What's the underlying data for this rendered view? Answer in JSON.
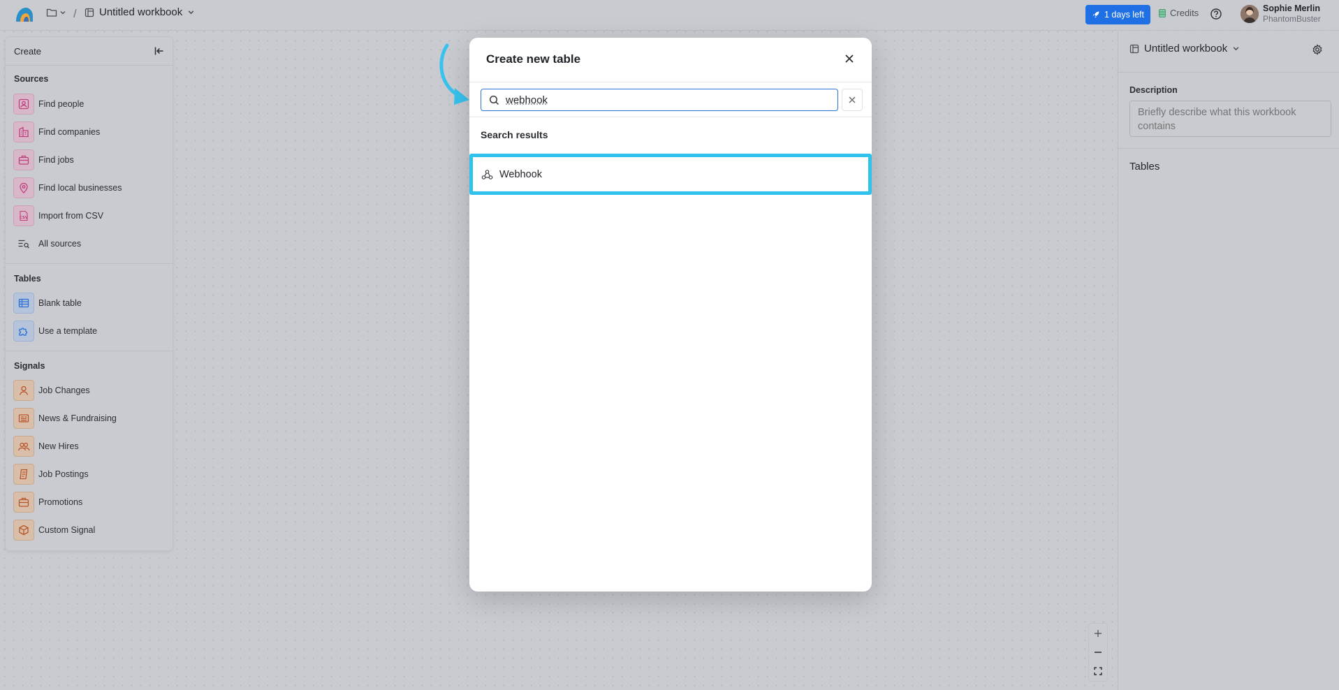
{
  "topbar": {
    "workbook_title": "Untitled workbook",
    "breadcrumb_separator": "/",
    "trial_label": "1 days left",
    "credits_label": "Credits",
    "user_name": "Sophie Merlin",
    "user_org": "PhantomBuster"
  },
  "left_panel": {
    "header": "Create",
    "sections": {
      "sources": "Sources",
      "tables": "Tables",
      "signals": "Signals"
    },
    "sources": [
      {
        "label": "Find people",
        "icon": "person-card-icon"
      },
      {
        "label": "Find companies",
        "icon": "building-icon"
      },
      {
        "label": "Find jobs",
        "icon": "briefcase-icon"
      },
      {
        "label": "Find local businesses",
        "icon": "map-pin-icon"
      },
      {
        "label": "Import from CSV",
        "icon": "csv-file-icon"
      },
      {
        "label": "All sources",
        "icon": "list-search-icon"
      }
    ],
    "tables": [
      {
        "label": "Blank table",
        "icon": "table-icon"
      },
      {
        "label": "Use a template",
        "icon": "puzzle-icon"
      }
    ],
    "signals": [
      {
        "label": "Job Changes",
        "icon": "person-icon"
      },
      {
        "label": "News & Fundraising",
        "icon": "newspaper-icon"
      },
      {
        "label": "New Hires",
        "icon": "people-icon"
      },
      {
        "label": "Job Postings",
        "icon": "notepad-icon"
      },
      {
        "label": "Promotions",
        "icon": "briefcase-icon"
      },
      {
        "label": "Custom Signal",
        "icon": "cube-icon"
      }
    ]
  },
  "right_panel": {
    "title": "Untitled workbook",
    "description_label": "Description",
    "description_placeholder": "Briefly describe what this workbook contains",
    "tables_label": "Tables"
  },
  "modal": {
    "title": "Create new table",
    "search_value": "webhook",
    "results_heading": "Search results",
    "results": [
      {
        "label": "Webhook",
        "icon": "webhook-icon"
      }
    ]
  },
  "colors": {
    "accent": "#1f6fe5",
    "highlight": "#2fc2ec",
    "canvas": "#c9cbd0"
  }
}
